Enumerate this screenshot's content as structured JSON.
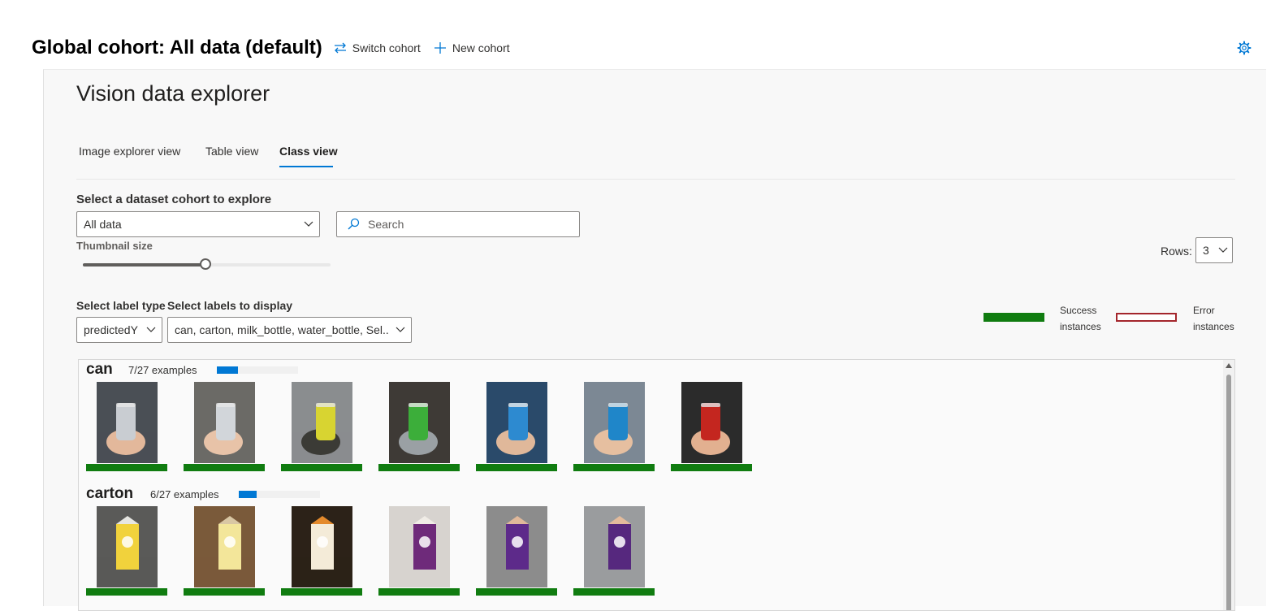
{
  "header": {
    "cohort_title": "Global cohort: All data (default)",
    "switch_cohort": "Switch cohort",
    "new_cohort": "New cohort",
    "settings_icon": "gear-icon"
  },
  "explorer": {
    "title": "Vision data explorer",
    "tabs": [
      {
        "label": "Image explorer view",
        "active": false
      },
      {
        "label": "Table view",
        "active": false
      },
      {
        "label": "Class view",
        "active": true
      }
    ],
    "cohort_select_label": "Select a dataset cohort to explore",
    "cohort_select_value": "All data",
    "search_placeholder": "Search",
    "thumbnail_size_label": "Thumbnail size",
    "thumbnail_size_fraction": 0.5,
    "rows_label": "Rows:",
    "rows_value": "3",
    "label_type_label": "Select label type",
    "label_type_value": "predictedY",
    "labels_display_label": "Select labels to display",
    "labels_display_value": "can, carton, milk_bottle, water_bottle, Sel...",
    "legend": {
      "success_line1": "Success",
      "success_line2": "instances",
      "error_line1": "Error",
      "error_line2": "instances",
      "success_color": "#107c10",
      "error_color": "#a4262c"
    }
  },
  "groups": [
    {
      "name": "can",
      "count_text": "7/27 examples",
      "fraction": 0.259,
      "images": [
        {
          "subject": "silver can in hand",
          "status": "success",
          "palette": [
            "#4a4f55",
            "#c9cdd2",
            "#e3b89b"
          ]
        },
        {
          "subject": "silver can held upside down",
          "status": "success",
          "palette": [
            "#6b6a66",
            "#d2d6da",
            "#e8c3a8"
          ]
        },
        {
          "subject": "yellow green can on table",
          "status": "success",
          "palette": [
            "#8a8d8f",
            "#d8d431",
            "#3b3b36"
          ]
        },
        {
          "subject": "green can in kitchen",
          "status": "success",
          "palette": [
            "#3e3a36",
            "#3cae3a",
            "#9aa0a4"
          ]
        },
        {
          "subject": "blue can in hand",
          "status": "success",
          "palette": [
            "#2a4a6a",
            "#2d8ad0",
            "#e0b89a"
          ]
        },
        {
          "subject": "blue can held up",
          "status": "success",
          "palette": [
            "#7c8894",
            "#1f86c9",
            "#e6bfa0"
          ]
        },
        {
          "subject": "red can in hand",
          "status": "success",
          "palette": [
            "#2b2b2b",
            "#c4261f",
            "#e2b090"
          ]
        }
      ]
    },
    {
      "name": "carton",
      "count_text": "6/27 examples",
      "fraction": 0.222,
      "images": [
        {
          "subject": "yellow carton on table",
          "status": "success",
          "palette": [
            "#5a5a58",
            "#f1d23c",
            "#e6e6e2"
          ]
        },
        {
          "subject": "carton on chessboard",
          "status": "success",
          "palette": [
            "#7a5a3a",
            "#f3e69a",
            "#d9c7a4"
          ]
        },
        {
          "subject": "orange carton on table",
          "status": "success",
          "palette": [
            "#2c2218",
            "#f4ebd8",
            "#e48a2c"
          ]
        },
        {
          "subject": "purple carton against wall",
          "status": "success",
          "palette": [
            "#d7d3cf",
            "#6e2a7a",
            "#f0ece6"
          ]
        },
        {
          "subject": "purple carton in hand",
          "status": "success",
          "palette": [
            "#8c8c8c",
            "#5d2a8a",
            "#e0b89a"
          ]
        },
        {
          "subject": "purple carton held sideways",
          "status": "success",
          "palette": [
            "#9a9c9e",
            "#56287e",
            "#e3bb9c"
          ]
        }
      ]
    }
  ]
}
